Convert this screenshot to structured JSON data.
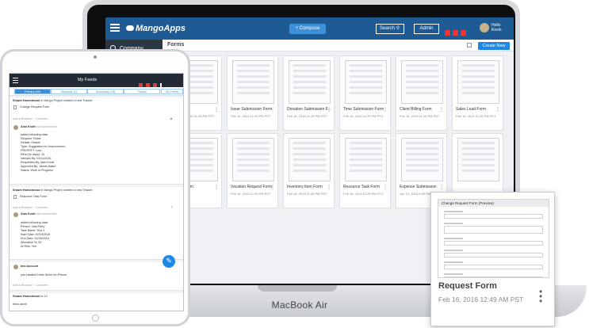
{
  "laptop": {
    "brand": "MacBook Air",
    "header": {
      "logo": "MangoApps",
      "compose_label": "+ Compose",
      "search_label": "Search",
      "admin_label": "Admin",
      "hello": "Hello",
      "user": "Kevin"
    },
    "sidebar": {
      "company_label": "Company"
    },
    "content": {
      "title": "Forms",
      "create_label": "Create New",
      "cards": [
        {
          "name": "",
          "date": "Feb 16, 2016 11:29 PM PST"
        },
        {
          "name": "Issue Submission Form",
          "date": "Feb 16, 2016 11:29 PM PST"
        },
        {
          "name": "Donation Submission F...",
          "date": "Feb 16, 2016 11:29 PM PST"
        },
        {
          "name": "Time Submission Form",
          "date": "Feb 16, 2016 11:29 PM PST"
        },
        {
          "name": "Client Billing Form",
          "date": "Feb 16, 2016 11:29 PM PST"
        },
        {
          "name": "Sales Lead Form",
          "date": "Feb 16, 2016 11:29 PM PST"
        },
        {
          "name": "ation Form",
          "date": "PM PST"
        },
        {
          "name": "Vacation Request Form",
          "date": "Feb 16, 2016 11:29 PM PST"
        },
        {
          "name": "Inventory Item Form",
          "date": "Feb 16, 2016 11:29 PM PST"
        },
        {
          "name": "Resource Task Form",
          "date": "Feb 16, 2016 11:29 PM PST"
        },
        {
          "name": "Expense Submission",
          "date": "Jan 12, 2016 6:39 PM PST"
        },
        {
          "name": "",
          "date": ""
        }
      ]
    }
  },
  "popup": {
    "form_title": "Change Request Form (Preview)",
    "name": "Request Form",
    "date": "Feb 16, 2016 12:49 AM PST"
  },
  "tablet": {
    "header_title": "My Feeds",
    "tabs": [
      "Primary (46)",
      "Mentions (1)",
      "Secondary (78)",
      "Pinned",
      "My Feeds"
    ],
    "posts": [
      {
        "title_user": "Shawn Hasselwood",
        "title_rest": " in Mango Project created a new Tracker",
        "item": "Change Request Form",
        "meta": "Add a Reaction · Comment",
        "count": "11",
        "commenter": "Alan Knott",
        "commenter_meta": "last commented",
        "lines": [
          "added following data:",
          "Request: Tester",
          "Details: Details",
          "Type: Suggestion for Improvement",
          "PRIORITY: Low",
          "Effort (in days): 10",
          "Needed By: 02/11/2016",
          "Requested By: Alan Knott",
          "Approved By: James Baker",
          "Status: Work in Progress"
        ]
      },
      {
        "title_user": "Shawn Hasselwood",
        "title_rest": " in Mango Project created a new Tracker",
        "item": "Resource Task Form",
        "meta": "Add a Reaction · Comment",
        "count": "7",
        "commenter": "Alan Knott",
        "commenter_meta": "last commented",
        "lines": [
          "added following data:",
          "Person: Lisa Parry",
          "Task Name: Test 3",
          "Start Date: 02/10/2016",
          "End Date: 02/26/2016",
          "Allocation %: 50",
          "At Risk: Yes"
        ]
      },
      {
        "title_user": "test Account",
        "text": "just installed Hello World for iPhone.",
        "meta": "Add a Reaction · Comment"
      },
      {
        "title_user": "Shawn Hasselwood",
        "title_rest": " to 13",
        "text": "hello world"
      }
    ]
  }
}
